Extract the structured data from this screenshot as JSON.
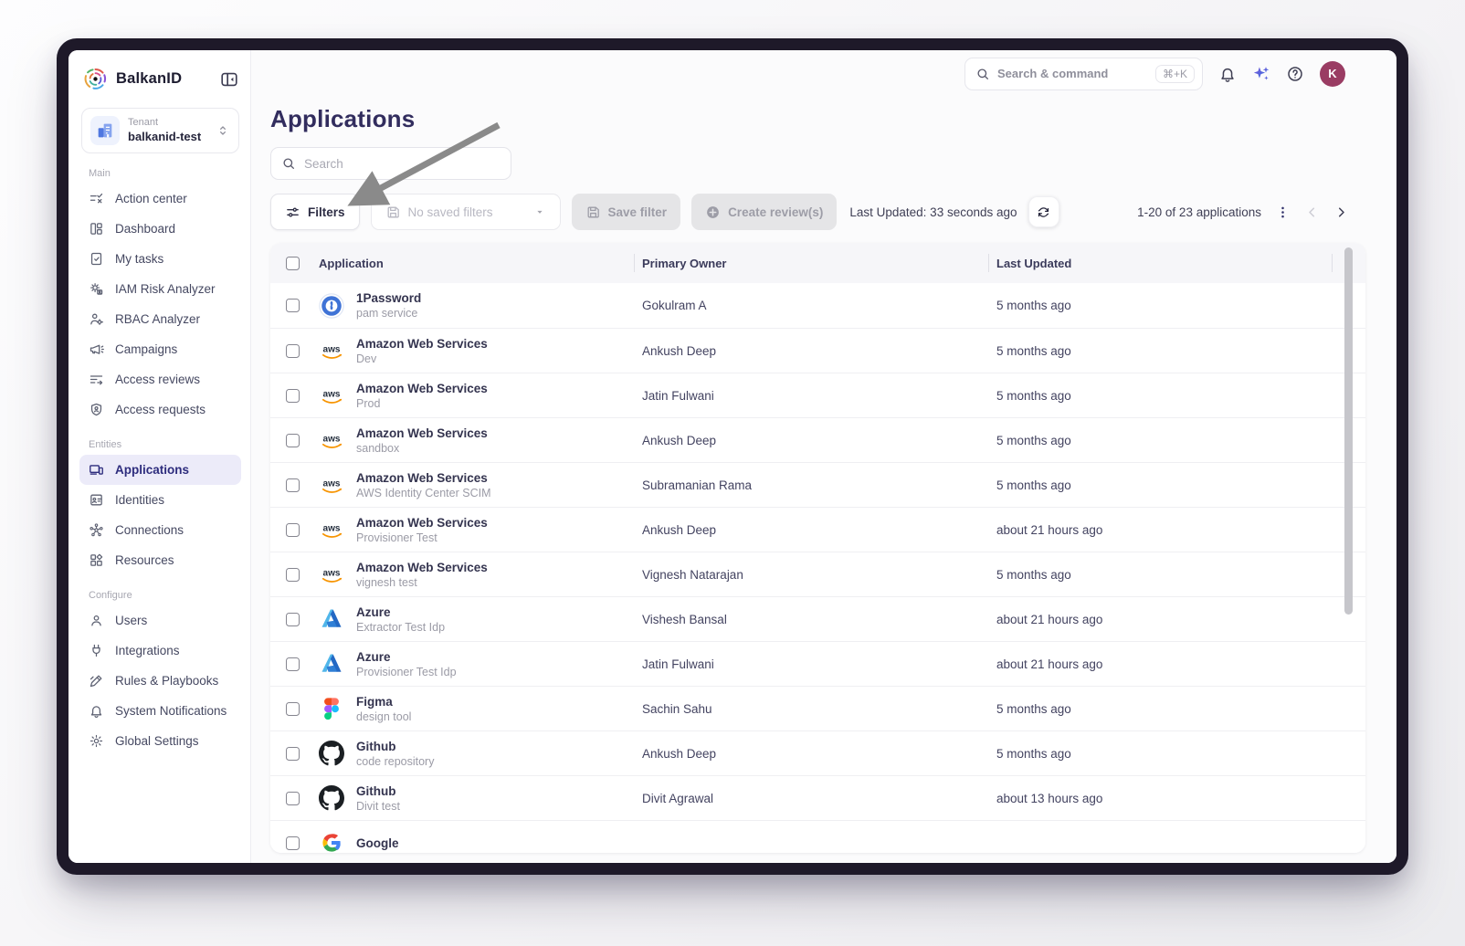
{
  "brand": {
    "name": "BalkanID"
  },
  "sidebar": {
    "tenant": {
      "label": "Tenant",
      "name": "balkanid-test"
    },
    "sections": [
      {
        "label": "Main",
        "items": [
          {
            "icon": "action-center",
            "label": "Action center"
          },
          {
            "icon": "dashboard",
            "label": "Dashboard"
          },
          {
            "icon": "my-tasks",
            "label": "My tasks"
          },
          {
            "icon": "iam-risk-analyzer",
            "label": "IAM Risk Analyzer"
          },
          {
            "icon": "rbac-analyzer",
            "label": "RBAC Analyzer"
          },
          {
            "icon": "campaigns",
            "label": "Campaigns"
          },
          {
            "icon": "access-reviews",
            "label": "Access reviews"
          },
          {
            "icon": "access-requests",
            "label": "Access requests"
          }
        ]
      },
      {
        "label": "Entities",
        "items": [
          {
            "icon": "applications",
            "label": "Applications",
            "active": true
          },
          {
            "icon": "identities",
            "label": "Identities"
          },
          {
            "icon": "connections",
            "label": "Connections"
          },
          {
            "icon": "resources",
            "label": "Resources"
          }
        ]
      },
      {
        "label": "Configure",
        "items": [
          {
            "icon": "users",
            "label": "Users"
          },
          {
            "icon": "integrations",
            "label": "Integrations"
          },
          {
            "icon": "rules-playbooks",
            "label": "Rules & Playbooks"
          },
          {
            "icon": "system-notifications",
            "label": "System Notifications"
          },
          {
            "icon": "global-settings",
            "label": "Global Settings"
          }
        ]
      }
    ]
  },
  "topbar": {
    "search_placeholder": "Search & command",
    "shortcut": "⌘+K",
    "avatar_initial": "K"
  },
  "page": {
    "title": "Applications",
    "search_placeholder": "Search"
  },
  "toolbar": {
    "filters_label": "Filters",
    "saved_filters_placeholder": "No saved filters",
    "save_filter_label": "Save filter",
    "create_reviews_label": "Create review(s)",
    "last_updated": "Last Updated: 33 seconds ago",
    "pagination": "1-20 of 23 applications"
  },
  "table": {
    "columns": [
      "Application",
      "Primary Owner",
      "Last Updated"
    ],
    "rows": [
      {
        "icon": "1password",
        "app": "1Password",
        "subtitle": "pam service",
        "owner": "Gokulram A",
        "updated": "5 months ago"
      },
      {
        "icon": "aws",
        "app": "Amazon Web Services",
        "subtitle": "Dev",
        "owner": "Ankush Deep",
        "updated": "5 months ago"
      },
      {
        "icon": "aws",
        "app": "Amazon Web Services",
        "subtitle": "Prod",
        "owner": "Jatin Fulwani",
        "updated": "5 months ago"
      },
      {
        "icon": "aws",
        "app": "Amazon Web Services",
        "subtitle": "sandbox",
        "owner": "Ankush Deep",
        "updated": "5 months ago"
      },
      {
        "icon": "aws",
        "app": "Amazon Web Services",
        "subtitle": "AWS Identity Center SCIM",
        "owner": "Subramanian Rama",
        "updated": "5 months ago"
      },
      {
        "icon": "aws",
        "app": "Amazon Web Services",
        "subtitle": "Provisioner Test",
        "owner": "Ankush Deep",
        "updated": "about 21 hours ago"
      },
      {
        "icon": "aws",
        "app": "Amazon Web Services",
        "subtitle": "vignesh test",
        "owner": "Vignesh Natarajan",
        "updated": "5 months ago"
      },
      {
        "icon": "azure",
        "app": "Azure",
        "subtitle": "Extractor Test Idp",
        "owner": "Vishesh Bansal",
        "updated": "about 21 hours ago"
      },
      {
        "icon": "azure",
        "app": "Azure",
        "subtitle": "Provisioner Test Idp",
        "owner": "Jatin Fulwani",
        "updated": "about 21 hours ago"
      },
      {
        "icon": "figma",
        "app": "Figma",
        "subtitle": "design tool",
        "owner": "Sachin Sahu",
        "updated": "5 months ago"
      },
      {
        "icon": "github",
        "app": "Github",
        "subtitle": "code repository",
        "owner": "Ankush Deep",
        "updated": "5 months ago"
      },
      {
        "icon": "github",
        "app": "Github",
        "subtitle": "Divit test",
        "owner": "Divit Agrawal",
        "updated": "about 13 hours ago"
      },
      {
        "icon": "google",
        "app": "Google",
        "subtitle": "",
        "owner": "",
        "updated": ""
      }
    ]
  },
  "colors": {
    "accent": "#2d2c7d",
    "active_bg": "#ecebf9",
    "avatar_bg": "#9a3c63",
    "frame": "#1e1929",
    "annotation_arrow": "#8a8a8a"
  }
}
